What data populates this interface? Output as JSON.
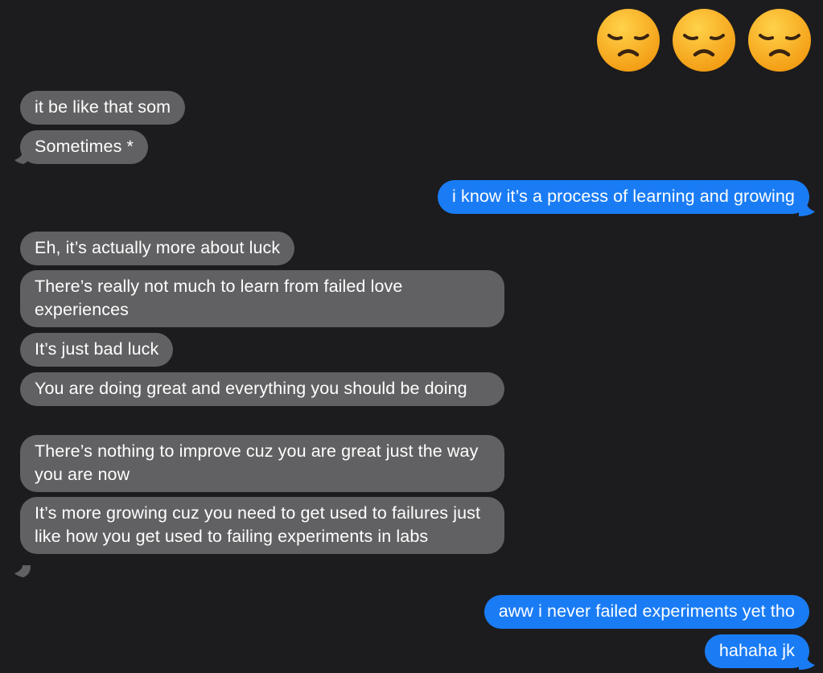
{
  "reaction": {
    "emojis": [
      "disappointed-face-emoji",
      "disappointed-face-emoji",
      "disappointed-face-emoji"
    ]
  },
  "messages": [
    {
      "side": "received",
      "text": "it be like that som"
    },
    {
      "side": "received",
      "text": "Sometimes *"
    },
    {
      "side": "sent",
      "text": "i know it’s a process of learning and growing"
    },
    {
      "side": "received",
      "text": "Eh, it’s actually more about luck"
    },
    {
      "side": "received",
      "text": "There’s really not much to learn from failed love experiences"
    },
    {
      "side": "received",
      "text": "It’s just bad luck"
    },
    {
      "side": "received",
      "text": "You are doing great and everything you should be doing"
    },
    {
      "side": "received",
      "text": "There’s nothing to improve cuz you are great just the way you are now"
    },
    {
      "side": "received",
      "text": "It’s more growing cuz you need to get used to failures just like how you get used to failing experiments in labs"
    },
    {
      "side": "sent",
      "text": "aww i never failed experiments yet tho"
    },
    {
      "side": "sent",
      "text": "hahaha jk"
    }
  ],
  "colors": {
    "background": "#1c1c1e",
    "received_bubble": "#616163",
    "sent_bubble": "#1a7cf5",
    "text": "#ffffff",
    "emoji_face": "#f7b125"
  }
}
